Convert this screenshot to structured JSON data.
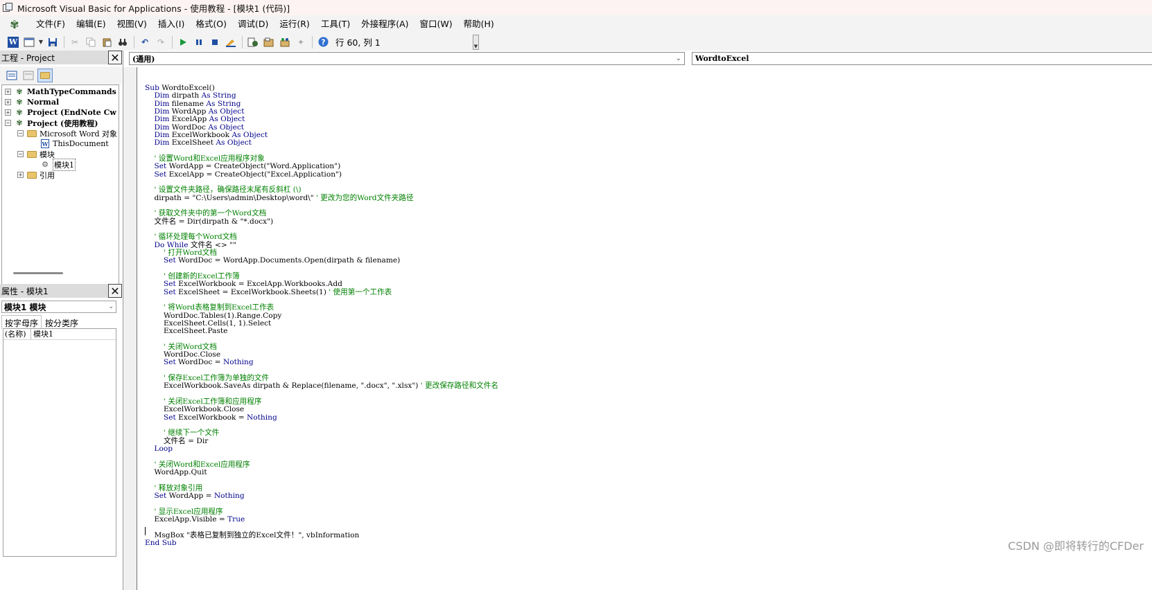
{
  "window": {
    "title": "Microsoft Visual Basic for Applications - 使用教程 - [模块1 (代码)]"
  },
  "menu": {
    "items": [
      "文件(F)",
      "编辑(E)",
      "视图(V)",
      "插入(I)",
      "格式(O)",
      "调试(D)",
      "运行(R)",
      "工具(T)",
      "外接程序(A)",
      "窗口(W)",
      "帮助(H)"
    ]
  },
  "toolbar": {
    "cursor_position": "行 60, 列 1"
  },
  "project_pane": {
    "title": "工程 - Project",
    "tree": [
      {
        "label": "MathTypeCommands (M",
        "bold": true
      },
      {
        "label": "Normal",
        "bold": true
      },
      {
        "label": "Project (EndNote Cw",
        "bold": true
      },
      {
        "label": "Project (使用教程)",
        "bold": true
      },
      {
        "label": "Microsoft Word 对象"
      },
      {
        "label": "ThisDocument"
      },
      {
        "label": "模块"
      },
      {
        "label": "模块1"
      },
      {
        "label": "引用"
      }
    ]
  },
  "properties_pane": {
    "title": "属性 - 模块1",
    "object_select": "模块1 模块",
    "tabs": [
      "按字母序",
      "按分类序"
    ],
    "rows": [
      {
        "key": "(名称)",
        "value": "模块1"
      }
    ]
  },
  "code_window": {
    "object_combo": "(通用)",
    "procedure_combo": "WordtoExcel",
    "lines": [
      "Sub WordtoExcel()",
      "    Dim dirpath As String",
      "    Dim filename As String",
      "    Dim WordApp As Object",
      "    Dim ExcelApp As Object",
      "    Dim WordDoc As Object",
      "    Dim ExcelWorkbook As Object",
      "    Dim ExcelSheet As Object",
      "",
      "    ' 设置Word和Excel应用程序对象",
      "    Set WordApp = CreateObject(\"Word.Application\")",
      "    Set ExcelApp = CreateObject(\"Excel.Application\")",
      "",
      "    ' 设置文件夹路径，确保路径末尾有反斜杠 (\\)",
      "    dirpath = \"C:\\Users\\admin\\Desktop\\word\\\" ' 更改为您的Word文件夹路径",
      "",
      "    ' 获取文件夹中的第一个Word文档",
      "    文件名 = Dir(dirpath & \"*.docx\")",
      "",
      "    ' 循环处理每个Word文档",
      "    Do While 文件名 <> \"\"",
      "        ' 打开Word文档",
      "        Set WordDoc = WordApp.Documents.Open(dirpath & filename)",
      "",
      "        ' 创建新的Excel工作簿",
      "        Set ExcelWorkbook = ExcelApp.Workbooks.Add",
      "        Set ExcelSheet = ExcelWorkbook.Sheets(1) ' 使用第一个工作表",
      "",
      "        ' 将Word表格复制到Excel工作表",
      "        WordDoc.Tables(1).Range.Copy",
      "        ExcelSheet.Cells(1, 1).Select",
      "        ExcelSheet.Paste",
      "",
      "        ' 关闭Word文档",
      "        WordDoc.Close",
      "        Set WordDoc = Nothing",
      "",
      "        ' 保存Excel工作簿为单独的文件",
      "        ExcelWorkbook.SaveAs dirpath & Replace(filename, \".docx\", \".xlsx\") ' 更改保存路径和文件名",
      "",
      "        ' 关闭Excel工作簿和应用程序",
      "        ExcelWorkbook.Close",
      "        Set ExcelWorkbook = Nothing",
      "",
      "        ' 继续下一个文件",
      "        文件名 = Dir",
      "    Loop",
      "",
      "    ' 关闭Word和Excel应用程序",
      "    WordApp.Quit",
      "",
      "    ' 释放对象引用",
      "    Set WordApp = Nothing",
      "",
      "    ' 显示Excel应用程序",
      "    ExcelApp.Visible = True",
      "",
      "    MsgBox \"表格已复制到独立的Excel文件！\", vbInformation",
      "End Sub"
    ]
  },
  "watermark": "CSDN @即将转行的CFDer",
  "colors": {
    "keyword": "#00008b",
    "comment": "#008000",
    "accent": "#1e4fa3"
  }
}
